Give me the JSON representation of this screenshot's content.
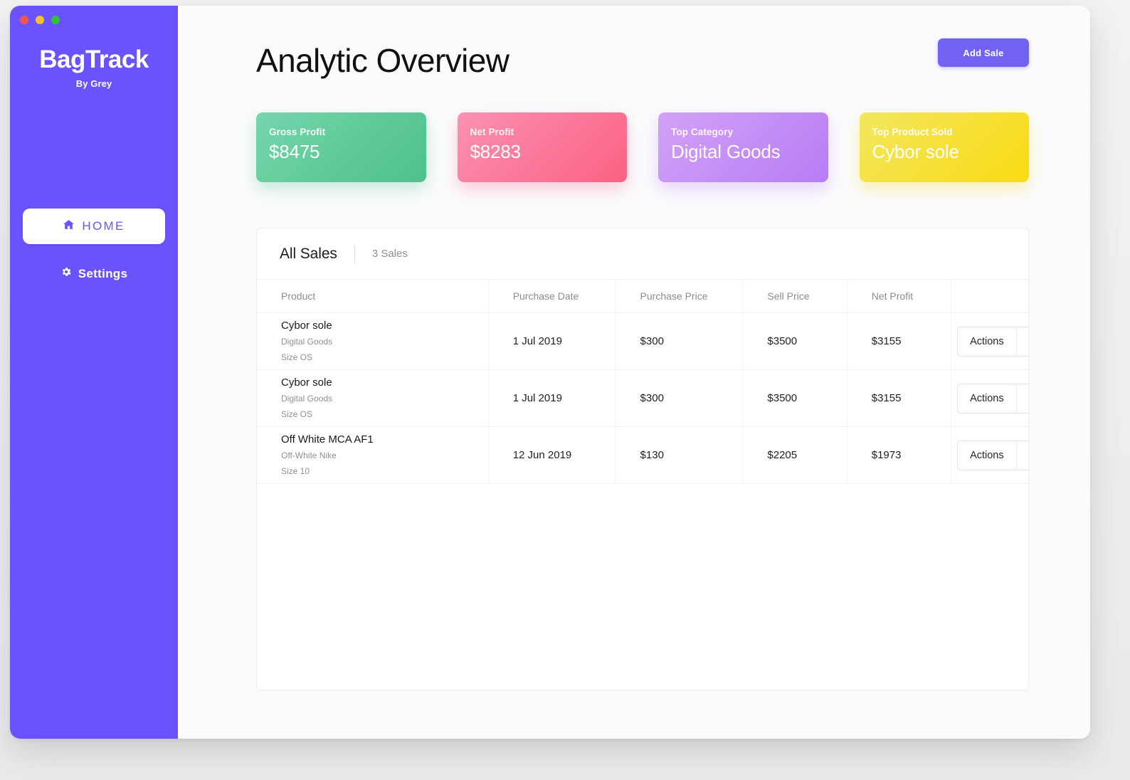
{
  "window": {
    "traffic_lights": [
      {
        "name": "close",
        "color": "#f2554c"
      },
      {
        "name": "minimize",
        "color": "#f5bf2e"
      },
      {
        "name": "maximize",
        "color": "#30c13f"
      }
    ]
  },
  "sidebar": {
    "brand_title": "BagTrack",
    "brand_subtitle": "By Grey",
    "items": [
      {
        "label": "HOME",
        "icon": "home-icon",
        "active": true
      },
      {
        "label": "Settings",
        "icon": "gear-icon",
        "active": false
      }
    ]
  },
  "header": {
    "title": "Analytic Overview",
    "add_sale_label": "Add Sale"
  },
  "stats": [
    {
      "label": "Gross Profit",
      "value": "$8475",
      "color": "#4ec08b",
      "theme": "green"
    },
    {
      "label": "Net Profit",
      "value": "$8283",
      "color": "#fb6183",
      "theme": "pink"
    },
    {
      "label": "Top Category",
      "value": "Digital Goods",
      "color": "#b87cf5",
      "theme": "purple"
    },
    {
      "label": "Top Product Sold",
      "value": "Cybor sole",
      "color": "#fada12",
      "theme": "yellow"
    }
  ],
  "table": {
    "tab_label": "All Sales",
    "count_label": "3 Sales",
    "columns": [
      "Product",
      "Purchase Date",
      "Purchase Price",
      "Sell Price",
      "Net Profit",
      ""
    ],
    "actions_label": "Actions",
    "rows": [
      {
        "product": "Cybor sole",
        "category": "Digital Goods",
        "size": "Size OS",
        "purchase_date": "1 Jul 2019",
        "purchase_price": "$300",
        "sell_price": "$3500",
        "net_profit": "$3155",
        "actions": "Actions"
      },
      {
        "product": "Cybor sole",
        "category": "Digital Goods",
        "size": "Size OS",
        "purchase_date": "1 Jul 2019",
        "purchase_price": "$300",
        "sell_price": "$3500",
        "net_profit": "$3155",
        "actions": "Actions"
      },
      {
        "product": "Off White MCA AF1",
        "category": "Off-White Nike",
        "size": "Size 10",
        "purchase_date": "12 Jun 2019",
        "purchase_price": "$130",
        "sell_price": "$2205",
        "net_profit": "$1973",
        "actions": "Actions"
      }
    ]
  },
  "colors": {
    "brand_purple": "#6b53fb",
    "button_purple": "#7262f2",
    "page_background": "#f2f2f2",
    "card_background": "#ffffff"
  }
}
